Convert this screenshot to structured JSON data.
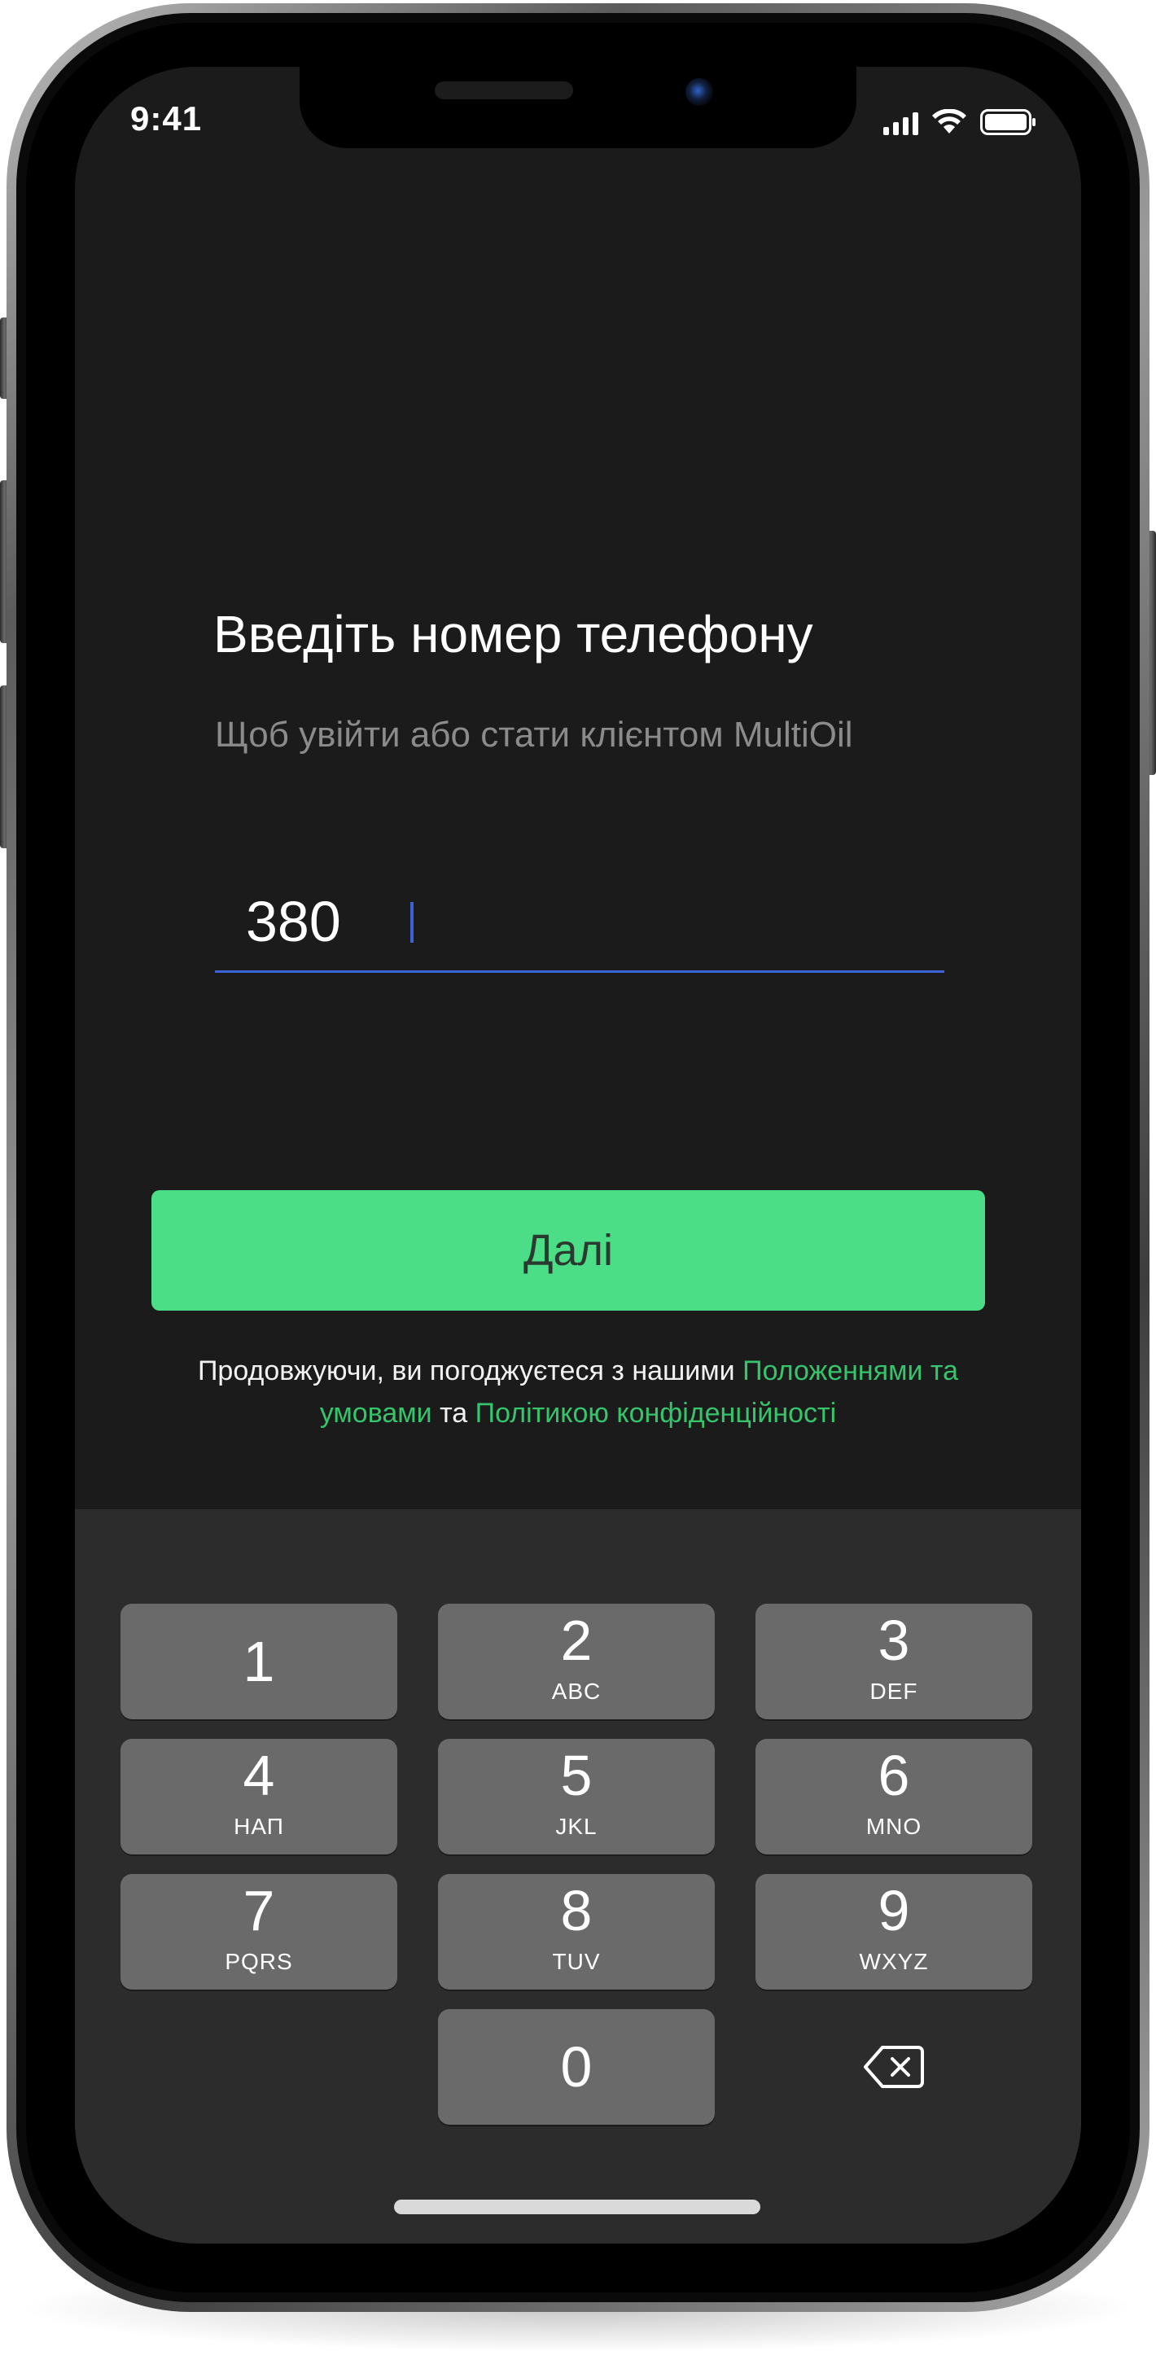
{
  "status_bar": {
    "time": "9:41"
  },
  "screen": {
    "title": "Введіть номер телефону",
    "subtitle": "Щоб увійти або стати клієнтом MultiOil",
    "phone_input": {
      "value": "380"
    },
    "next_button": "Далі",
    "legal": {
      "prefix": "Продовжуючи, ви погоджуєтеся з нашими ",
      "terms_link": "Положеннями та умовами",
      "conjunction": " та ",
      "privacy_link": "Політикою конфіденційності"
    }
  },
  "keypad": {
    "keys": [
      {
        "digit": "1",
        "letters": ""
      },
      {
        "digit": "2",
        "letters": "ABC"
      },
      {
        "digit": "3",
        "letters": "DEF"
      },
      {
        "digit": "4",
        "letters": "НАП"
      },
      {
        "digit": "5",
        "letters": "JKL"
      },
      {
        "digit": "6",
        "letters": "MNO"
      },
      {
        "digit": "7",
        "letters": "PQRS"
      },
      {
        "digit": "8",
        "letters": "TUV"
      },
      {
        "digit": "9",
        "letters": "WXYZ"
      },
      {
        "digit": "0",
        "letters": ""
      }
    ],
    "delete_icon": "backspace-icon"
  },
  "colors": {
    "background": "#1b1b1b",
    "accent_green": "#4bde87",
    "link_green": "#36c46d",
    "input_underline": "#3b63d6",
    "keypad_background": "#2c2c2c",
    "key_background": "#6a6a6a"
  }
}
